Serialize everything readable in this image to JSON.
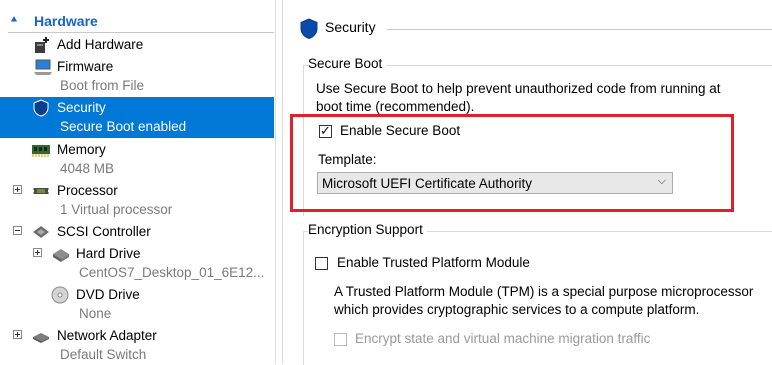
{
  "tree": {
    "header": "Hardware",
    "items": [
      {
        "label": "Add Hardware",
        "sub": null,
        "icon": "add-hardware-icon"
      },
      {
        "label": "Firmware",
        "sub": "Boot from File",
        "icon": "firmware-icon"
      },
      {
        "label": "Security",
        "sub": "Secure Boot enabled",
        "icon": "shield-icon",
        "selected": true
      },
      {
        "label": "Memory",
        "sub": "4048 MB",
        "icon": "memory-icon"
      },
      {
        "label": "Processor",
        "sub": "1 Virtual processor",
        "icon": "processor-icon"
      },
      {
        "label": "SCSI Controller",
        "sub": null,
        "icon": "scsi-controller-icon"
      },
      {
        "label": "Hard Drive",
        "sub": "CentOS7_Desktop_01_6E12...",
        "icon": "hard-drive-icon"
      },
      {
        "label": "DVD Drive",
        "sub": "None",
        "icon": "dvd-drive-icon"
      },
      {
        "label": "Network Adapter",
        "sub": "Default Switch",
        "icon": "network-adapter-icon"
      }
    ]
  },
  "security": {
    "title": "Security",
    "secure_boot": {
      "legend": "Secure Boot",
      "description_line1": "Use Secure Boot to help prevent unauthorized code from running at",
      "description_line2": "boot time (recommended).",
      "enable_label": "Enable Secure Boot",
      "enable_checked": true,
      "template_label": "Template:",
      "template_value": "Microsoft UEFI Certificate Authority"
    },
    "encryption": {
      "legend": "Encryption Support",
      "tpm_label": "Enable Trusted Platform Module",
      "tpm_checked": false,
      "tpm_desc_line1": "A Trusted Platform Module (TPM) is a special purpose microprocessor",
      "tpm_desc_line2": "which provides cryptographic services to a compute platform.",
      "encrypt_label": "Encrypt state and virtual machine migration traffic",
      "encrypt_checked": false
    }
  },
  "colors": {
    "selection": "#0078d7",
    "accent": "#1a63c8",
    "highlight_border": "#e0202a"
  }
}
